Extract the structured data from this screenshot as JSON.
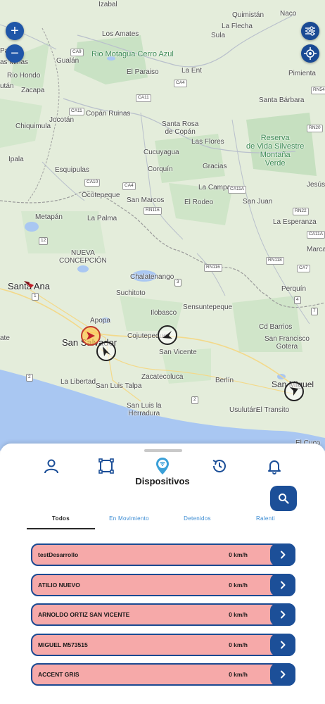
{
  "map": {
    "places": [
      {
        "id": "izabal",
        "text": "Izabal"
      },
      {
        "id": "quimistan",
        "text": "Quimistán"
      },
      {
        "id": "naco",
        "text": "Naco"
      },
      {
        "id": "la-flecha",
        "text": "La Flecha"
      },
      {
        "id": "sula",
        "text": "Sula"
      },
      {
        "id": "parque",
        "text": "Parque"
      },
      {
        "id": "las-minas",
        "text": "as Minas"
      },
      {
        "id": "los-amates",
        "text": "Los Amates"
      },
      {
        "id": "gualan",
        "text": "Gualán"
      },
      {
        "id": "rio-motagua",
        "text": "Rio Motagua\nCerro Azul"
      },
      {
        "id": "el-paraiso",
        "text": "El Paraiso"
      },
      {
        "id": "la-ent",
        "text": "La Ent"
      },
      {
        "id": "pimienta",
        "text": "Pimienta"
      },
      {
        "id": "rio-hondo",
        "text": "Rio Hondo"
      },
      {
        "id": "zacapa",
        "text": "Zacapa"
      },
      {
        "id": "utan",
        "text": "után"
      },
      {
        "id": "santa-barbara",
        "text": "Santa Bárbara"
      },
      {
        "id": "copan-ruinas",
        "text": "Copán Ruinas"
      },
      {
        "id": "jocotan",
        "text": "Jocotán"
      },
      {
        "id": "chiquimula",
        "text": "Chiquimula"
      },
      {
        "id": "santa-rosa",
        "text": "Santa Rosa\nde Copán"
      },
      {
        "id": "reserva",
        "text": "Reserva\nde Vida Silvestre\nMontaña\nVerde"
      },
      {
        "id": "las-flores",
        "text": "Las Flores"
      },
      {
        "id": "cucuyagua",
        "text": "Cucuyagua"
      },
      {
        "id": "ipala",
        "text": "Ipala"
      },
      {
        "id": "esquipulas",
        "text": "Esquipulas"
      },
      {
        "id": "corquin",
        "text": "Corquín"
      },
      {
        "id": "gracias",
        "text": "Gracias"
      },
      {
        "id": "la-campa",
        "text": "La Campa"
      },
      {
        "id": "jesus",
        "text": "Jesús"
      },
      {
        "id": "ocotepeque",
        "text": "Ocotepeque"
      },
      {
        "id": "san-marcos",
        "text": "San Marcos"
      },
      {
        "id": "el-rodeo",
        "text": "El Rodeo"
      },
      {
        "id": "san-juan",
        "text": "San Juan"
      },
      {
        "id": "metapan",
        "text": "Metapán"
      },
      {
        "id": "la-palma",
        "text": "La Palma"
      },
      {
        "id": "la-esperanza",
        "text": "La Esperanza"
      },
      {
        "id": "nueva-concepcion",
        "text": "NUEVA\nCONCEPCIÓN"
      },
      {
        "id": "marcala",
        "text": "Marcal"
      },
      {
        "id": "chalatenango",
        "text": "Chalatenango"
      },
      {
        "id": "santa-ana",
        "text": "Santa Ana"
      },
      {
        "id": "suchitoto",
        "text": "Suchitoto"
      },
      {
        "id": "perquin",
        "text": "Perquín"
      },
      {
        "id": "sensuntepeque",
        "text": "Sensuntepeque"
      },
      {
        "id": "ilobasco",
        "text": "Ilobasco"
      },
      {
        "id": "apopa",
        "text": "Apopa"
      },
      {
        "id": "cd-barrios",
        "text": "Cd Barrios"
      },
      {
        "id": "ate",
        "text": "ate"
      },
      {
        "id": "san-salvador",
        "text": "San Salvador"
      },
      {
        "id": "cojutepeque",
        "text": "Cojutepeque"
      },
      {
        "id": "san-vicente",
        "text": "San Vicente"
      },
      {
        "id": "san-francisco-gotera",
        "text": "San Francisco\nGotera"
      },
      {
        "id": "zacatecoluca",
        "text": "Zacatecoluca"
      },
      {
        "id": "la-libertad",
        "text": "La Libertad"
      },
      {
        "id": "san-luis-talpa",
        "text": "San Luis Talpa"
      },
      {
        "id": "berlin",
        "text": "Berlín"
      },
      {
        "id": "san-miguel",
        "text": "San Miguel"
      },
      {
        "id": "san-luis-herradura",
        "text": "San Luis la\nHerradura"
      },
      {
        "id": "usulutan",
        "text": "Usulután"
      },
      {
        "id": "el-transito",
        "text": "El Transito"
      },
      {
        "id": "el-cuco",
        "text": "El Cuco"
      }
    ],
    "roads": [
      {
        "id": "ca9",
        "text": "CA9"
      },
      {
        "id": "ca4a",
        "text": "CA4"
      },
      {
        "id": "ca11a",
        "text": "CA11"
      },
      {
        "id": "ca11b",
        "text": "CA11"
      },
      {
        "id": "ca10",
        "text": "CA10"
      },
      {
        "id": "ca4b",
        "text": "CA4"
      },
      {
        "id": "ca11a2",
        "text": "CA11A"
      },
      {
        "id": "rn116",
        "text": "RN116"
      },
      {
        "id": "rn116b",
        "text": "RN116"
      },
      {
        "id": "rn22",
        "text": "RN22"
      },
      {
        "id": "ca11ab",
        "text": "CA11A"
      },
      {
        "id": "rn118",
        "text": "RN118"
      },
      {
        "id": "ca7",
        "text": "CA7"
      },
      {
        "id": "rn54",
        "text": "RN54"
      },
      {
        "id": "rn20",
        "text": "RN20"
      },
      {
        "id": "r12",
        "text": "12"
      },
      {
        "id": "r1",
        "text": "1"
      },
      {
        "id": "r3",
        "text": "3"
      },
      {
        "id": "r2",
        "text": "2"
      },
      {
        "id": "r2b",
        "text": "2"
      },
      {
        "id": "r4",
        "text": "4"
      },
      {
        "id": "r7",
        "text": "7"
      }
    ],
    "zoom_in": "+",
    "zoom_out": "−"
  },
  "nav": {
    "title": "Dispositivos"
  },
  "tabs": [
    {
      "label": "Todos",
      "active": true
    },
    {
      "label": "En Movimiento",
      "active": false
    },
    {
      "label": "Detenidos",
      "active": false
    },
    {
      "label": "Ralenti",
      "active": false
    }
  ],
  "devices": [
    {
      "name": "testDesarrollo",
      "speed": "0 km/h"
    },
    {
      "name": "ATILIO NUEVO",
      "speed": "0 km/h"
    },
    {
      "name": "ARNOLDO ORTIZ SAN VICENTE",
      "speed": "0 km/h"
    },
    {
      "name": "MIGUEL M573515",
      "speed": "0 km/h"
    },
    {
      "name": "ACCENT GRIS",
      "speed": "0 km/h"
    }
  ],
  "colors": {
    "primary": "#1c4f98",
    "row_bg": "#f6a9a9",
    "tab_inactive": "#3a8bd3",
    "nav_active": "#3aa0d8"
  }
}
